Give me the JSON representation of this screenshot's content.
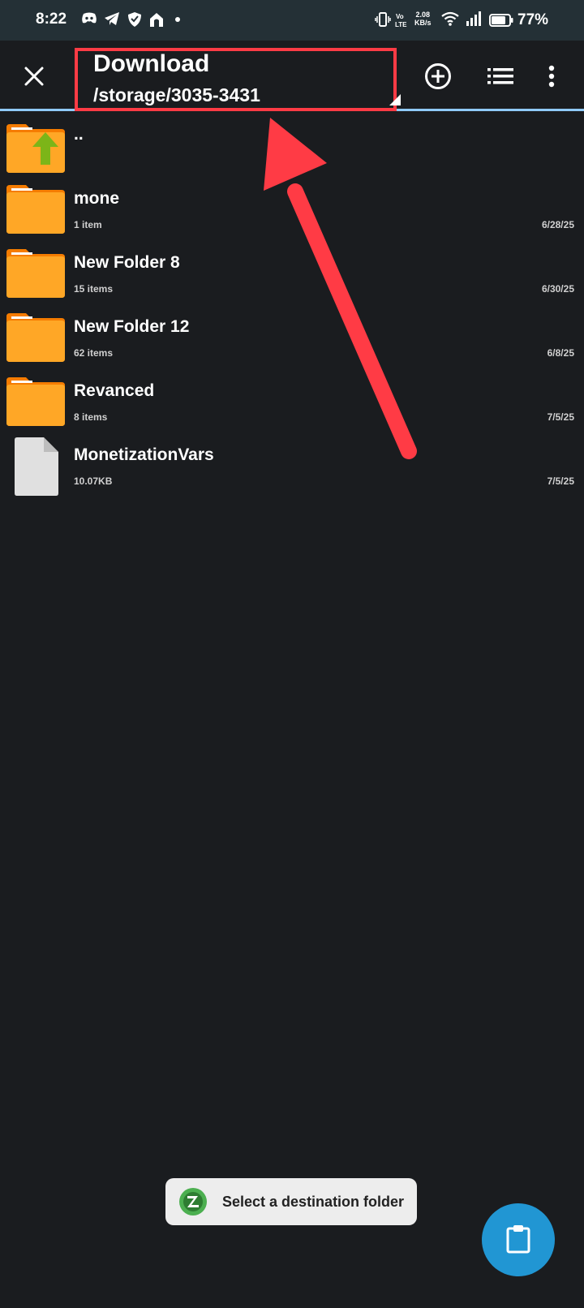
{
  "status_bar": {
    "time": "8:22",
    "net_speed_value": "2.08",
    "net_speed_unit": "KB/s",
    "battery": "77%",
    "icons": [
      "discord-icon",
      "telegram-icon",
      "shield-icon",
      "home-icon",
      "dot-icon",
      "vibrate-icon",
      "volte-icon",
      "wifi-icon",
      "signal-icon",
      "battery-icon"
    ]
  },
  "app_bar": {
    "title": "Download",
    "path": "/storage/3035-3431",
    "highlight_color": "#ff3b45",
    "accent_color": "#90caf9"
  },
  "files": [
    {
      "name": "..",
      "meta": "",
      "date": "",
      "icon": "folder-up-icon"
    },
    {
      "name": "mone",
      "meta": "1 item",
      "date": "6/28/25",
      "icon": "folder-icon"
    },
    {
      "name": "New Folder 8",
      "meta": "15 items",
      "date": "6/30/25",
      "icon": "folder-icon"
    },
    {
      "name": "New Folder 12",
      "meta": "62 items",
      "date": "6/8/25",
      "icon": "folder-icon"
    },
    {
      "name": "Revanced",
      "meta": "8 items",
      "date": "7/5/25",
      "icon": "folder-icon"
    },
    {
      "name": "MonetizationVars",
      "meta": "10.07KB",
      "date": "7/5/25",
      "icon": "file-icon"
    }
  ],
  "toast": {
    "message": "Select a destination folder"
  },
  "fab": {
    "icon": "clipboard-icon",
    "color": "#2196d3"
  }
}
